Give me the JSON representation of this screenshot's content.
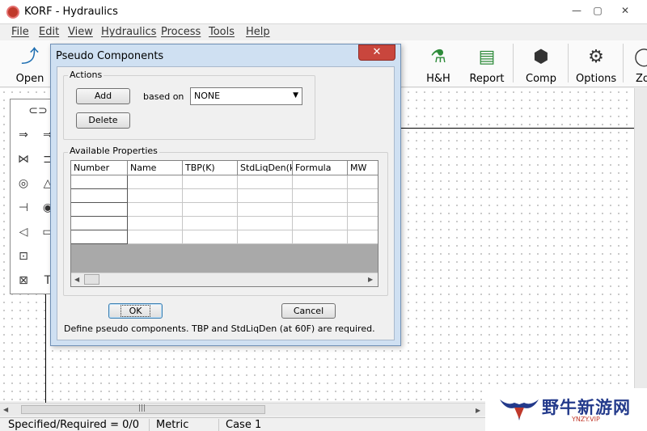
{
  "window": {
    "title": "KORF - Hydraulics",
    "minimize_glyph": "—",
    "maximize_glyph": "▢",
    "close_glyph": "✕"
  },
  "menu": [
    "File",
    "Edit",
    "View",
    "Hydraulics",
    "Process",
    "Tools",
    "Help"
  ],
  "toolbar": {
    "open": {
      "label": "Open",
      "icon": "open-file-icon",
      "glyph": "⤴"
    },
    "hh": {
      "label": "H&H",
      "icon": "flask-icon",
      "glyph": "⚗"
    },
    "report": {
      "label": "Report",
      "icon": "report-icon",
      "glyph": "▤"
    },
    "comp": {
      "label": "Comp",
      "icon": "molecule-icon",
      "glyph": "⬢"
    },
    "options": {
      "label": "Options",
      "icon": "gear-icon",
      "glyph": "⚙"
    },
    "partial_label": "Zo"
  },
  "palette": {
    "icons": [
      "pipe-icon",
      "feed-icon",
      "product-icon",
      "valve-icon",
      "vessel-icon",
      "pump-icon",
      "tank-icon",
      "compressor-icon",
      "heat-exchanger-icon",
      "junction-icon",
      "mixer-icon",
      "splitter-icon",
      "text-icon"
    ],
    "glyphs": [
      "⊂⊃",
      "⇒",
      "⇒",
      "⋈",
      "⊐",
      "◎",
      "△",
      "⊣",
      "◉",
      "◁",
      "▭",
      "⊡",
      "⊠",
      "T"
    ]
  },
  "dialog": {
    "title": "Pseudo Components",
    "close_glyph": "✕",
    "actions_group": "Actions",
    "add_button": "Add",
    "based_on_label": "based on",
    "based_on_value": "NONE",
    "dropdown_glyph": "▼",
    "delete_button": "Delete",
    "properties_group": "Available Properties",
    "columns": [
      "Number",
      "Name",
      "TBP(K)",
      "StdLiqDen(kg",
      "Formula",
      "MW"
    ],
    "row_count": 5,
    "ok_button": "OK",
    "cancel_button": "Cancel",
    "hint": "Define pseudo components. TBP and StdLiqDen (at 60F) are required.",
    "scroll_left_glyph": "◀",
    "scroll_right_glyph": "▶"
  },
  "scroll": {
    "left_glyph": "◀",
    "right_glyph": "▶",
    "thumb_glyph": "|||"
  },
  "status": {
    "specified": "Specified/Required = 0/0",
    "units": "Metric",
    "case": "Case 1"
  },
  "watermark": {
    "text": "野牛新游网",
    "url": "YNZY.VIP"
  }
}
